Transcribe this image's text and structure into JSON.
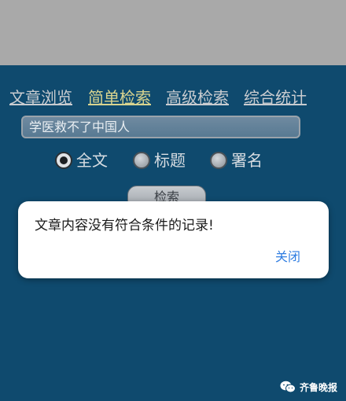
{
  "nav": {
    "items": [
      {
        "label": "文章浏览"
      },
      {
        "label": "简单检索",
        "active": true
      },
      {
        "label": "高级检索"
      },
      {
        "label": "综合统计"
      }
    ]
  },
  "search": {
    "value": "学医救不了中国人"
  },
  "scope": {
    "options": [
      {
        "label": "全文",
        "checked": true
      },
      {
        "label": "标题",
        "checked": false
      },
      {
        "label": "署名",
        "checked": false
      }
    ]
  },
  "search_button": {
    "label": "检索"
  },
  "dialog": {
    "message": "文章内容没有符合条件的记录!",
    "close_label": "关闭"
  },
  "watermark": {
    "text": "齐鲁晚报",
    "icon": "wechat-icon"
  },
  "colors": {
    "background": "#0f4a6e",
    "top_bar": "#a9a9a9",
    "nav_active": "#d9d48f",
    "dialog_action": "#2f7de1"
  }
}
